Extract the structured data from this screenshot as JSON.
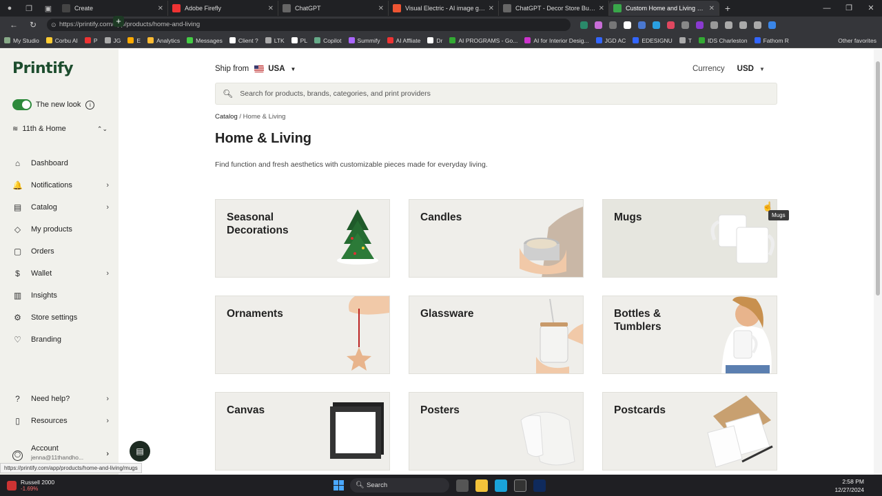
{
  "browser": {
    "tabs": [
      {
        "title": "Create",
        "color": "#444"
      },
      {
        "title": "Adobe Firefly",
        "color": "#e33"
      },
      {
        "title": "ChatGPT",
        "color": "#666"
      },
      {
        "title": "Visual Electric - AI image generat...",
        "color": "#e53"
      },
      {
        "title": "ChatGPT - Decor Store Buddy",
        "color": "#666"
      },
      {
        "title": "Custom Home and Living Pr...",
        "color": "#39a64a",
        "active": true
      }
    ],
    "url": "https://printify.com/app/products/home-and-living",
    "bookmarks": [
      "My Studio",
      "Corbu AI",
      "P",
      "JG",
      "E",
      "Analytics",
      "Messages",
      "Client ?",
      "LTK",
      "PL",
      "Copilot",
      "Summify",
      "AI Affliate",
      "Dr",
      "AI PROGRAMS - Go...",
      "AI for Interior Desig...",
      "JGD AC",
      "EDESIGNU",
      "T",
      "IDS Charleston",
      "Fathom R"
    ],
    "other_favorites": "Other favorites",
    "status_url": "https://printify.com/app/products/home-and-living/mugs"
  },
  "sidebar": {
    "logo": "Printify",
    "new_look": "The new look",
    "store": "11th & Home",
    "items": [
      {
        "label": "Dashboard",
        "icon": "home-icon",
        "glyph": "⌂",
        "chevron": false
      },
      {
        "label": "Notifications",
        "icon": "bell-icon",
        "glyph": "🔔",
        "chevron": true
      },
      {
        "label": "Catalog",
        "icon": "catalog-icon",
        "glyph": "▤",
        "chevron": true
      },
      {
        "label": "My products",
        "icon": "tag-icon",
        "glyph": "◇",
        "chevron": false
      },
      {
        "label": "Orders",
        "icon": "orders-icon",
        "glyph": "▢",
        "chevron": false
      },
      {
        "label": "Wallet",
        "icon": "dollar-icon",
        "glyph": "$",
        "chevron": true
      },
      {
        "label": "Insights",
        "icon": "chart-icon",
        "glyph": "▥",
        "chevron": false
      },
      {
        "label": "Store settings",
        "icon": "gear-icon",
        "glyph": "⚙",
        "chevron": false
      },
      {
        "label": "Branding",
        "icon": "heart-icon",
        "glyph": "♡",
        "chevron": false
      }
    ],
    "bottom_items": [
      {
        "label": "Need help?",
        "icon": "help-icon",
        "glyph": "?",
        "chevron": true
      },
      {
        "label": "Resources",
        "icon": "book-icon",
        "glyph": "▯",
        "chevron": true
      }
    ],
    "account": {
      "label": "Account",
      "email": "jenna@11thandho..."
    }
  },
  "header": {
    "ship_from_label": "Ship from",
    "ship_from_value": "USA",
    "currency_label": "Currency",
    "currency_value": "USD",
    "search_placeholder": "Search for products, brands, categories, and print providers"
  },
  "page": {
    "breadcrumb_root": "Catalog",
    "breadcrumb_current": "Home & Living",
    "title": "Home & Living",
    "description": "Find function and fresh aesthetics with customizable pieces made for everyday living."
  },
  "categories": [
    {
      "title": "Seasonal Decorations",
      "art": "tree"
    },
    {
      "title": "Candles",
      "art": "candle"
    },
    {
      "title": "Mugs",
      "art": "mug"
    },
    {
      "title": "Ornaments",
      "art": "ornament"
    },
    {
      "title": "Glassware",
      "art": "glass"
    },
    {
      "title": "Bottles & Tumblers",
      "art": "tumbler"
    },
    {
      "title": "Canvas",
      "art": "canvas"
    },
    {
      "title": "Posters",
      "art": "poster"
    },
    {
      "title": "Postcards",
      "art": "postcard"
    }
  ],
  "tooltip": "Mugs",
  "taskbar": {
    "ticker_name": "Russell 2000",
    "ticker_change": "-1.69%",
    "search": "Search",
    "time": "2:58 PM",
    "date": "12/27/2024"
  }
}
